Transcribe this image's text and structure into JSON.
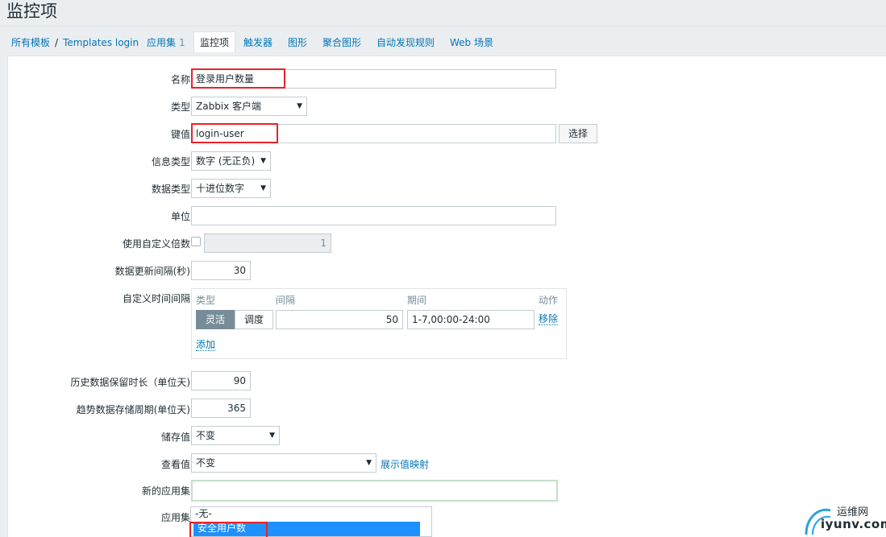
{
  "page": {
    "title": "监控项"
  },
  "nav": {
    "breadcrumb": [
      "所有模板",
      "Templates login"
    ],
    "tabs": [
      {
        "label": "应用集",
        "count": "1"
      },
      {
        "label": "监控项"
      },
      {
        "label": "触发器"
      },
      {
        "label": "图形"
      },
      {
        "label": "聚合图形"
      },
      {
        "label": "自动发现规则"
      },
      {
        "label": "Web 场景"
      }
    ]
  },
  "form": {
    "name": {
      "label": "名称",
      "value": "登录用户数量"
    },
    "type": {
      "label": "类型",
      "value": "Zabbix 客户端"
    },
    "key": {
      "label": "键值",
      "value": "login-user",
      "button": "选择"
    },
    "info_type": {
      "label": "信息类型",
      "value": "数字 (无正负)"
    },
    "data_type": {
      "label": "数据类型",
      "value": "十进位数字"
    },
    "units": {
      "label": "单位",
      "value": ""
    },
    "multiplier": {
      "label": "使用自定义倍数",
      "value": "1"
    },
    "update_interval": {
      "label": "数据更新间隔(秒)",
      "value": "30"
    },
    "custom_intervals": {
      "label": "自定义时间间隔",
      "headers": {
        "type": "类型",
        "interval": "间隔",
        "period": "期间",
        "action": "动作"
      },
      "row": {
        "flexible": "灵活",
        "scheduling": "调度",
        "interval": "50",
        "period": "1-7,00:00-24:00",
        "remove": "移除"
      },
      "add": "添加"
    },
    "history": {
      "label": "历史数据保留时长（单位天)",
      "value": "90"
    },
    "trends": {
      "label": "趋势数据存储周期(单位天)",
      "value": "365"
    },
    "store_value": {
      "label": "储存值",
      "value": "不变"
    },
    "show_value": {
      "label": "查看值",
      "value": "不变",
      "link": "展示值映射"
    },
    "new_application": {
      "label": "新的应用集",
      "value": ""
    },
    "applications": {
      "label": "应用集",
      "options": [
        "-无-",
        "安全用户数"
      ]
    }
  },
  "watermark": {
    "name": "运维网",
    "url": "iyunv.com"
  },
  "colors": {
    "link": "#0275b8",
    "highlight": "#e8222b",
    "selected": "#1e90ff"
  }
}
